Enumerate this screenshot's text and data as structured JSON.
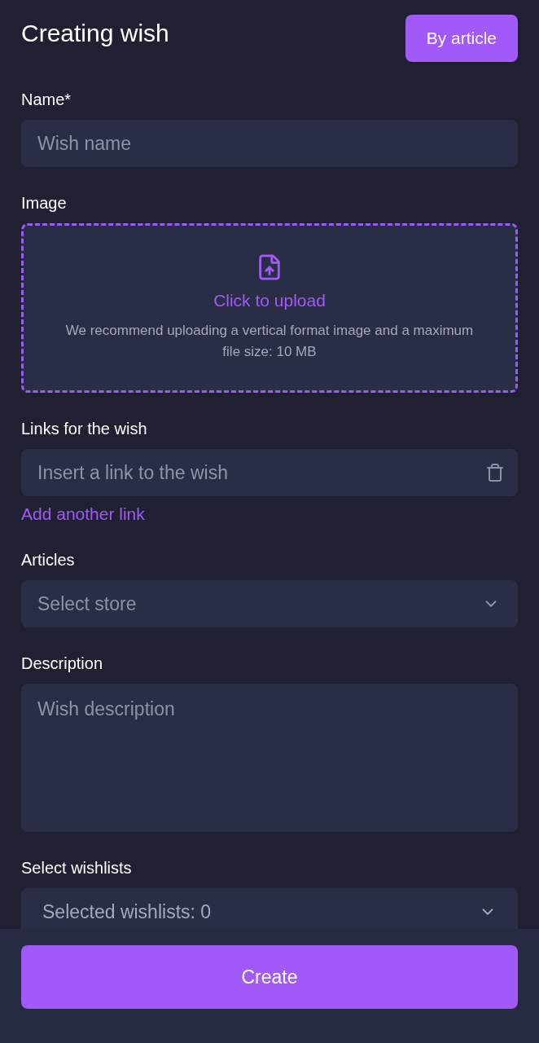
{
  "header": {
    "title": "Creating wish",
    "action_button": "By article"
  },
  "fields": [
    {
      "kind": "text",
      "label": "Name*",
      "placeholder": "Wish name"
    },
    {
      "kind": "upload",
      "label": "Image",
      "action": "Click to upload",
      "hint": "We recommend uploading a vertical format image and a maximum file size: 10 MB"
    },
    {
      "kind": "link",
      "label": "Links for the wish",
      "placeholder": "Insert a link to the wish",
      "add_link": "Add another link"
    },
    {
      "kind": "select",
      "label": "Articles",
      "placeholder": "Select store"
    },
    {
      "kind": "textarea",
      "label": "Description",
      "placeholder": "Wish description"
    },
    {
      "kind": "select",
      "label": "Select wishlists",
      "value": "Selected wishlists: 0"
    }
  ],
  "footer": {
    "button": "Create"
  }
}
